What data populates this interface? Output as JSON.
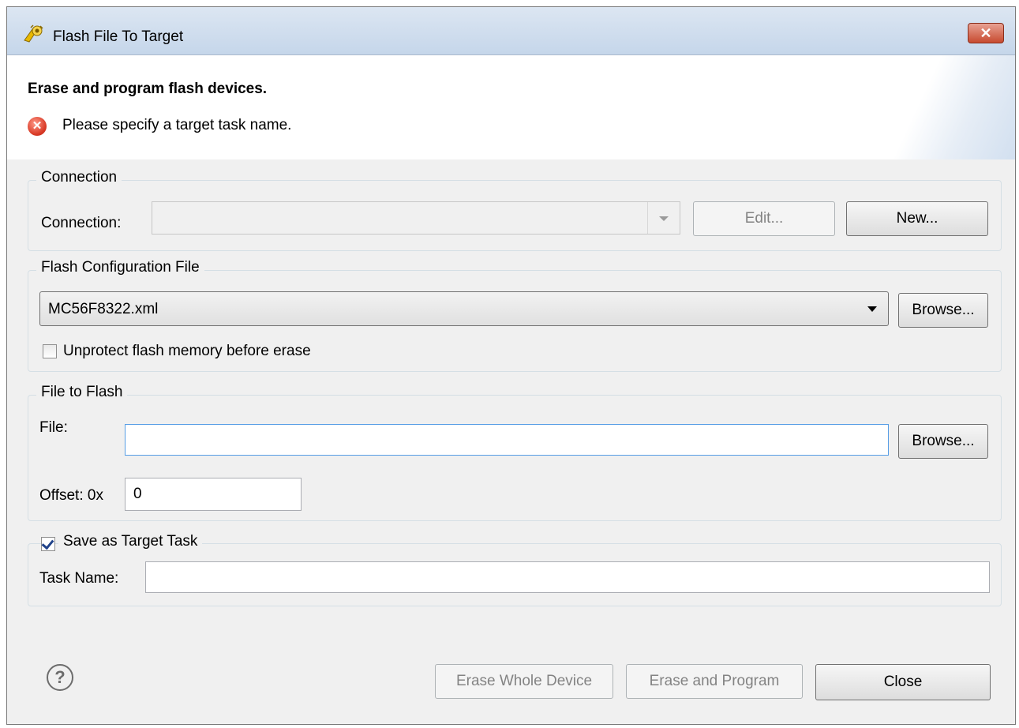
{
  "window": {
    "title": "Flash File To Target",
    "close_glyph": "✕"
  },
  "banner": {
    "title": "Erase and program flash devices.",
    "error_glyph": "✕",
    "error_message": "Please specify a target task name."
  },
  "connection": {
    "group_label": "Connection",
    "field_label": "Connection:",
    "value": "",
    "edit_button": "Edit...",
    "new_button": "New..."
  },
  "flash_config": {
    "group_label": "Flash Configuration File",
    "selected_file": "MC56F8322.xml",
    "browse_button": "Browse...",
    "unprotect_label": "Unprotect flash memory before erase",
    "unprotect_checked": false
  },
  "file_to_flash": {
    "group_label": "File to Flash",
    "file_label": "File:",
    "file_value": "",
    "browse_button": "Browse...",
    "offset_label": "Offset: 0x",
    "offset_value": "0"
  },
  "target_task": {
    "save_label": "Save as Target Task",
    "save_checked": true,
    "task_name_label": "Task Name:",
    "task_name_value": ""
  },
  "footer": {
    "help_glyph": "?",
    "erase_whole_button": "Erase Whole Device",
    "erase_program_button": "Erase and Program",
    "close_button": "Close"
  }
}
